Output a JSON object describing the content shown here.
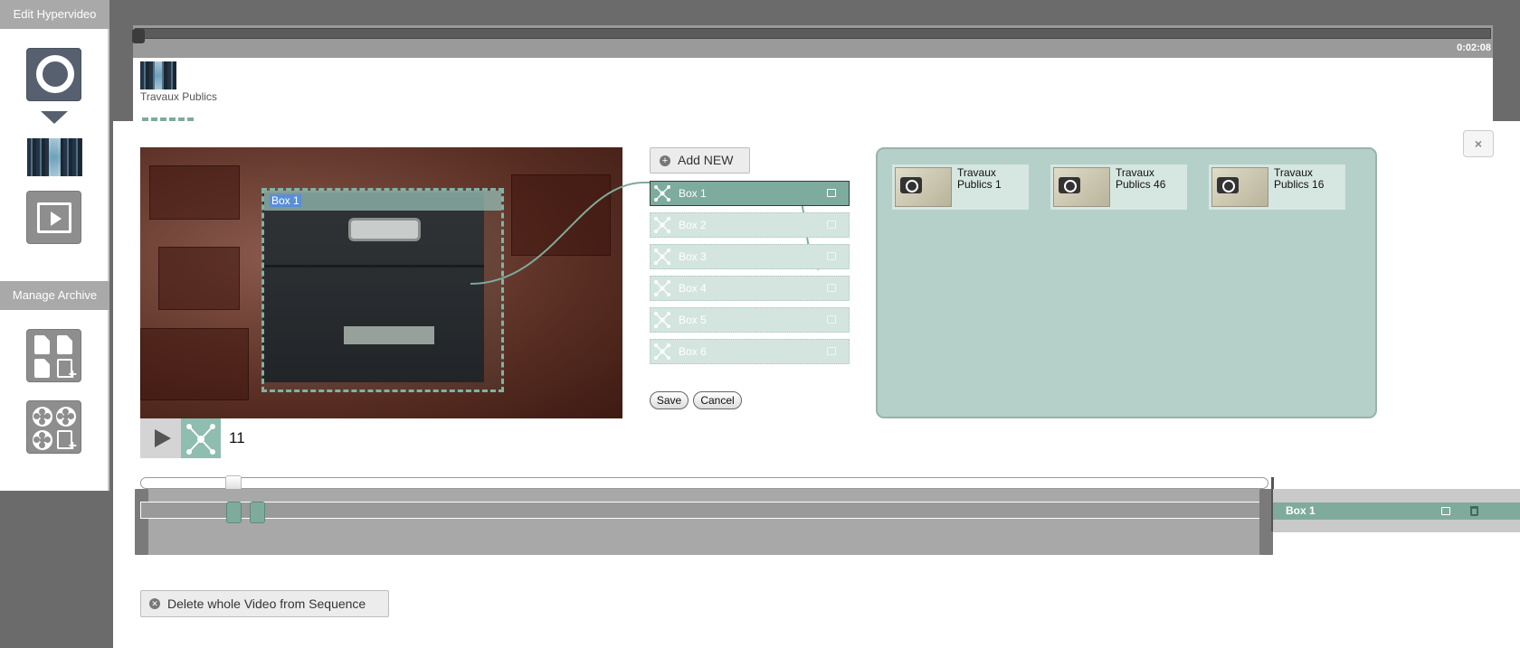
{
  "sidebar": {
    "edit_heading": "Edit Hypervideo",
    "archive_heading": "Manage Archive"
  },
  "top_timeline": {
    "duration": "0:02:08",
    "video_title": "Travaux Publics"
  },
  "panel": {
    "close_label": "×",
    "frame_count": "11",
    "overlay_label": "Box 1",
    "add_new_label": "Add NEW",
    "boxes": [
      {
        "label": "Box 1",
        "active": true
      },
      {
        "label": "Box 2",
        "active": false
      },
      {
        "label": "Box 3",
        "active": false
      },
      {
        "label": "Box 4",
        "active": false
      },
      {
        "label": "Box 5",
        "active": false
      },
      {
        "label": "Box 6",
        "active": false
      }
    ],
    "save_label": "Save",
    "cancel_label": "Cancel",
    "linked_items": [
      {
        "title": "Travaux Publics 1",
        "icon": "camera-icon"
      },
      {
        "title": "Travaux Publics 46",
        "icon": "camera-icon"
      },
      {
        "title": "Travaux Publics 16",
        "icon": "camera-icon"
      }
    ],
    "box_track_label": "Box 1",
    "delete_video_label": "Delete whole Video from Sequence"
  },
  "colors": {
    "accent": "#7dab9d",
    "accent_light": "#d4e5e0",
    "panel_bg": "#b4d0c9",
    "sidebar_heading": "#a9a9a9"
  }
}
